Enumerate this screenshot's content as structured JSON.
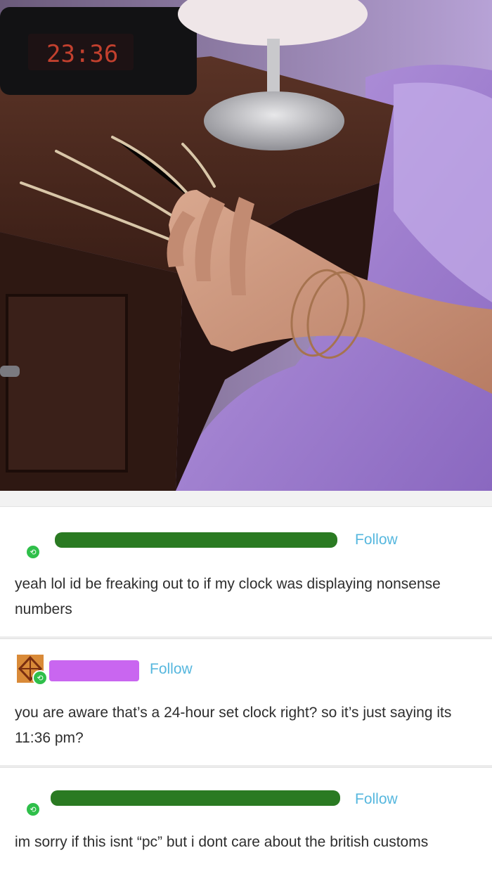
{
  "photo": {
    "clock_time": "23:36",
    "description_icon": "bedside-photo"
  },
  "posts": [
    {
      "follow_label": "Follow",
      "text": "yeah lol id be freaking out to if my clock was displaying nonsense numbers",
      "redact_color": "#2a7a22"
    },
    {
      "follow_label": "Follow",
      "text": "you are aware that’s a 24-hour set clock right? so it’s just saying its 11:36 pm?",
      "redact_color": "#c966f0"
    },
    {
      "follow_label": "Follow",
      "text": "im sorry if this isnt “pc” but i dont care about the british customs",
      "redact_color": "#2a7a22"
    }
  ],
  "colors": {
    "follow": "#56b7de",
    "reblog_badge": "#2fbf4a"
  }
}
